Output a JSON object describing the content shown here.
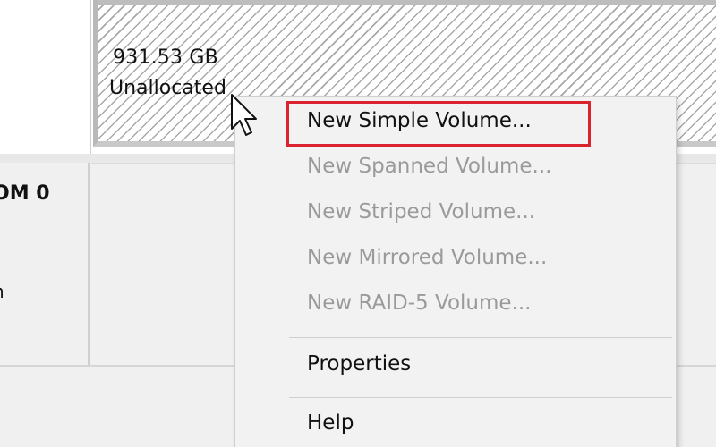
{
  "disk_top": {
    "unallocated": {
      "size": "931.53 GB",
      "status": "Unallocated"
    }
  },
  "disk_second": {
    "label": "OM 0",
    "sub": "n"
  },
  "context_menu": {
    "items": [
      {
        "label": "New Simple Volume...",
        "enabled": true,
        "highlighted": true
      },
      {
        "label": "New Spanned Volume...",
        "enabled": false
      },
      {
        "label": "New Striped Volume...",
        "enabled": false
      },
      {
        "label": "New Mirrored Volume...",
        "enabled": false
      },
      {
        "label": "New RAID-5 Volume...",
        "enabled": false
      },
      {
        "label": "Properties",
        "enabled": true
      },
      {
        "label": "Help",
        "enabled": true
      }
    ]
  },
  "colors": {
    "highlight": "#d9232e",
    "disabled_text": "#9a9a9a",
    "enabled_text": "#111111"
  },
  "icons": {
    "cursor": "arrow-pointer-icon"
  }
}
